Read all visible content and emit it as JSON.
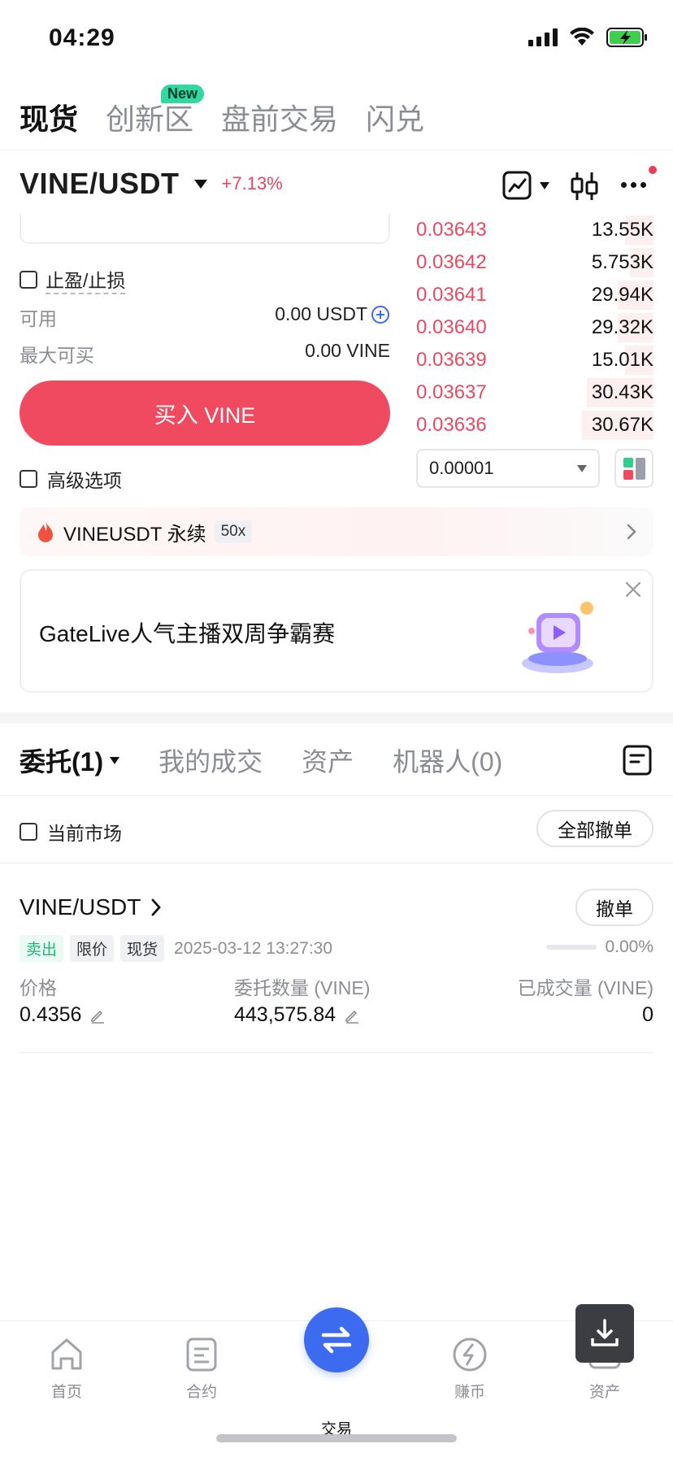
{
  "status_bar": {
    "time": "04:29"
  },
  "top_tabs": [
    {
      "label": "现货",
      "active": true
    },
    {
      "label": "创新区",
      "badge": "New"
    },
    {
      "label": "盘前交易"
    },
    {
      "label": "闪兑"
    }
  ],
  "pair": {
    "symbol": "VINE/USDT",
    "change": "+7.13%"
  },
  "order_form": {
    "tpsl_label": "止盈/止损",
    "available_label": "可用",
    "available_value": "0.00 USDT",
    "max_buy_label": "最大可买",
    "max_buy_value": "0.00 VINE",
    "buy_button": "买入 VINE",
    "advanced_label": "高级选项"
  },
  "order_book": {
    "asks": [
      {
        "price": "0.03643",
        "qty": "13.55K",
        "depth": 0.12
      },
      {
        "price": "0.03642",
        "qty": "5.753K",
        "depth": 0.1
      },
      {
        "price": "0.03641",
        "qty": "29.94K",
        "depth": 0.15
      },
      {
        "price": "0.03640",
        "qty": "29.32K",
        "depth": 0.15
      },
      {
        "price": "0.03639",
        "qty": "15.01K",
        "depth": 0.12
      },
      {
        "price": "0.03637",
        "qty": "30.43K",
        "depth": 0.28
      },
      {
        "price": "0.03636",
        "qty": "30.67K",
        "depth": 0.3
      }
    ],
    "precision": "0.00001"
  },
  "perpetual": {
    "label": "VINEUSDT 永续",
    "leverage": "50x"
  },
  "banner": {
    "text": "GateLive人气主播双周争霸赛"
  },
  "order_tabs": [
    {
      "label": "委托(1)",
      "active": true
    },
    {
      "label": "我的成交"
    },
    {
      "label": "资产"
    },
    {
      "label": "机器人(0)"
    }
  ],
  "filter": {
    "current_market_label": "当前市场",
    "cancel_all": "全部撤单"
  },
  "order": {
    "pair": "VINE/USDT",
    "cancel": "撤单",
    "side": "卖出",
    "type": "限价",
    "market": "现货",
    "time": "2025-03-12 13:27:30",
    "filled_pct": "0.00%",
    "price_label": "价格",
    "price": "0.4356",
    "amount_label": "委托数量 (VINE)",
    "amount": "443,575.84",
    "filled_label": "已成交量 (VINE)",
    "filled": "0"
  },
  "bottom_nav": [
    {
      "label": "首页"
    },
    {
      "label": "合约"
    },
    {
      "label": "交易",
      "active": true
    },
    {
      "label": "赚币"
    },
    {
      "label": "资产"
    }
  ],
  "colors": {
    "sell_red": "#ea4a61",
    "buy_button": "#f04a60",
    "accent_blue": "#3d6bf0",
    "sell_tag_green": "#22b37a"
  }
}
